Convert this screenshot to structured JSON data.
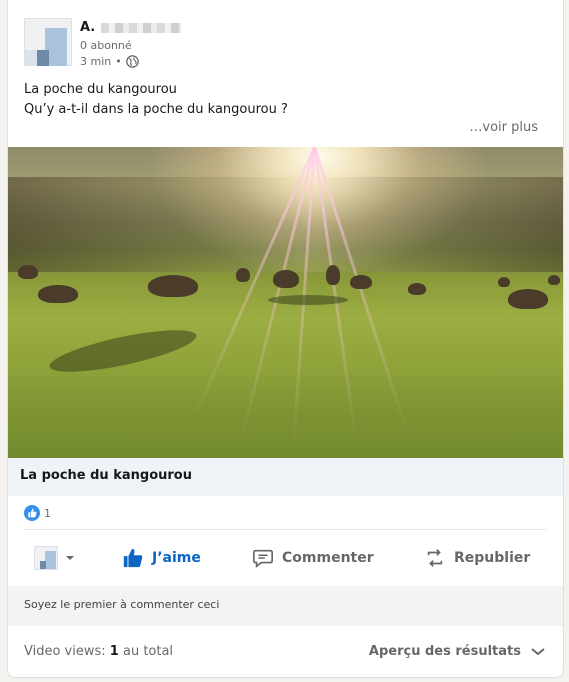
{
  "author": {
    "name": "A.",
    "followers": "0 abonné",
    "time": "3 min",
    "separator": "•",
    "visibility_icon": "globe-icon"
  },
  "post": {
    "line1": "La poche du kangourou",
    "line2": "Qu’y a-t-il dans la poche du kangourou ?",
    "see_more": "…voir plus"
  },
  "media": {
    "title": "La poche du kangourou"
  },
  "social": {
    "reaction_icon": "thumbs-up-icon",
    "reaction_count": "1"
  },
  "actions": {
    "like": "J’aime",
    "comment": "Commenter",
    "repost": "Republier"
  },
  "comment_prompt": "Soyez le premier à commenter ceci",
  "footer": {
    "views_label": "Video views:",
    "views_count": "1",
    "views_suffix": "au total",
    "analytics": "Aperçu des résultats"
  },
  "colors": {
    "accent": "#0a66c2",
    "like_bubble": "#378fe9",
    "media_title_bg": "#eef3f8"
  }
}
